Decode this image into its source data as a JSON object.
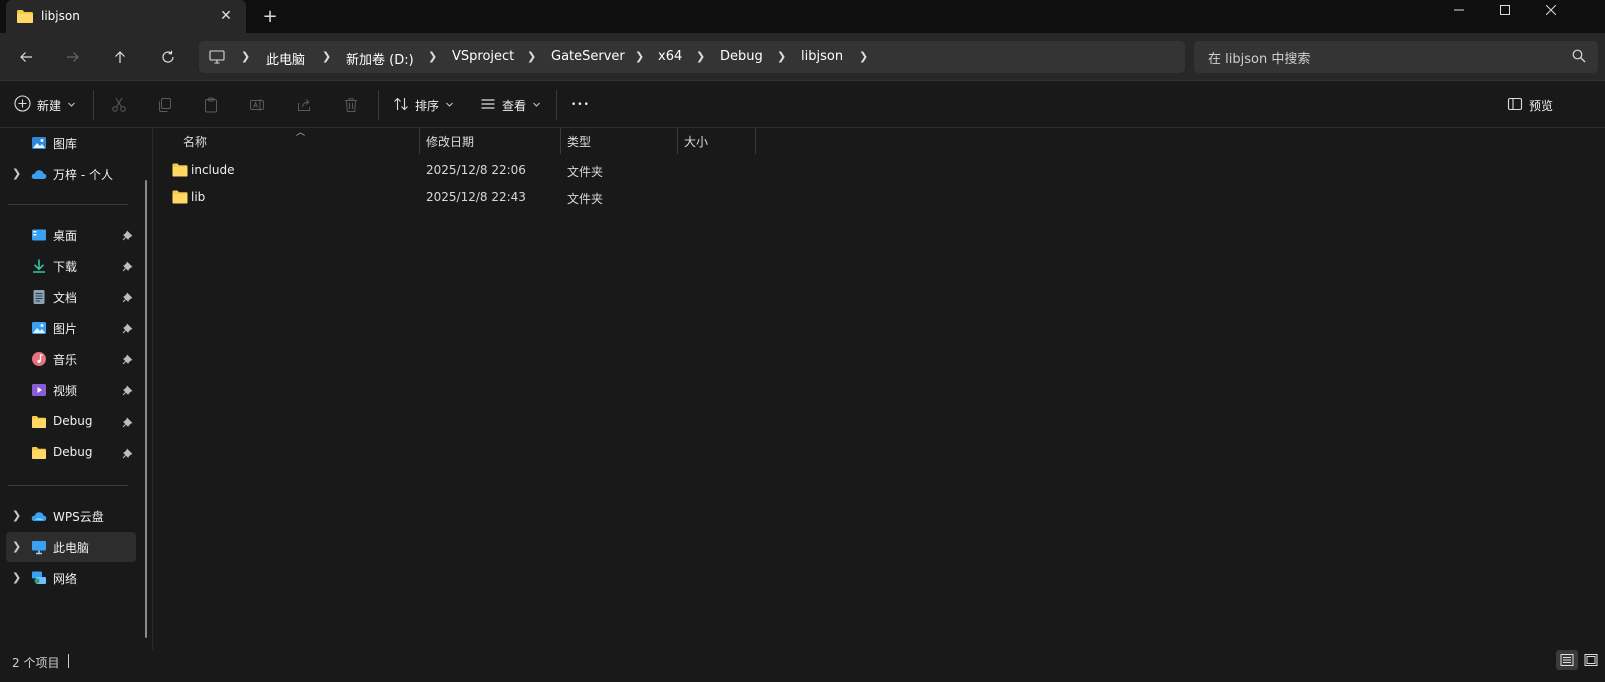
{
  "tab": {
    "title": "libjson",
    "close_glyph": "✕",
    "new_glyph": "+"
  },
  "address": {
    "crumbs": [
      "此电脑",
      "新加卷 (D:)",
      "VSproject",
      "GateServer",
      "x64",
      "Debug",
      "libjson"
    ]
  },
  "search": {
    "placeholder": "在 libjson 中搜索"
  },
  "toolbar": {
    "new_label": "新建",
    "sort_label": "排序",
    "view_label": "查看",
    "more_glyph": "•••",
    "preview_label": "预览"
  },
  "sidebar": {
    "items": [
      {
        "label": "图库",
        "icon": "gallery-icon"
      },
      {
        "label": "万梓 - 个人",
        "icon": "onedrive-icon"
      },
      {
        "label": "桌面",
        "icon": "desktop-icon",
        "pinned": true
      },
      {
        "label": "下载",
        "icon": "download-icon",
        "pinned": true
      },
      {
        "label": "文档",
        "icon": "document-icon",
        "pinned": true
      },
      {
        "label": "图片",
        "icon": "pictures-icon",
        "pinned": true
      },
      {
        "label": "音乐",
        "icon": "music-icon",
        "pinned": true
      },
      {
        "label": "视频",
        "icon": "video-icon",
        "pinned": true
      },
      {
        "label": "Debug",
        "icon": "folder-icon",
        "pinned": true
      },
      {
        "label": "Debug",
        "icon": "folder-icon",
        "pinned": true
      },
      {
        "label": "WPS云盘",
        "icon": "wps-cloud-icon"
      },
      {
        "label": "此电脑",
        "icon": "this-pc-icon",
        "selected": true
      },
      {
        "label": "网络",
        "icon": "network-icon"
      }
    ]
  },
  "columns": {
    "name": "名称",
    "modified": "修改日期",
    "type": "类型",
    "size": "大小"
  },
  "files": [
    {
      "name": "include",
      "modified": "2025/12/8 22:06",
      "type": "文件夹",
      "size": ""
    },
    {
      "name": "lib",
      "modified": "2025/12/8 22:43",
      "type": "文件夹",
      "size": ""
    }
  ],
  "status": {
    "item_count": "2 个项目"
  },
  "colors": {
    "folder": "#F7C948",
    "accent": "#4CC2FF",
    "background": "#191919"
  }
}
